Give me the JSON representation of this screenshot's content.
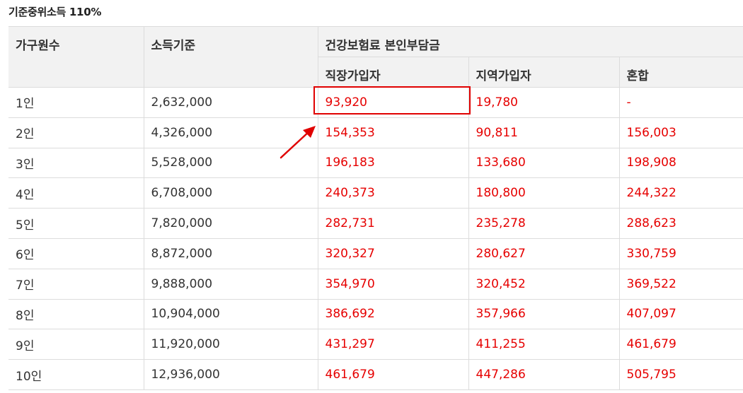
{
  "caption": "기준중위소득 110%",
  "headers": {
    "household": "가구원수",
    "income": "소득기준",
    "premium_group": "건강보험료 본인부담금",
    "employee": "직장가입자",
    "regional": "지역가입자",
    "mixed": "혼합"
  },
  "rows": [
    {
      "household": "1인",
      "income": "2,632,000",
      "employee": "93,920",
      "regional": "19,780",
      "mixed": "-"
    },
    {
      "household": "2인",
      "income": "4,326,000",
      "employee": "154,353",
      "regional": "90,811",
      "mixed": "156,003"
    },
    {
      "household": "3인",
      "income": "5,528,000",
      "employee": "196,183",
      "regional": "133,680",
      "mixed": "198,908"
    },
    {
      "household": "4인",
      "income": "6,708,000",
      "employee": "240,373",
      "regional": "180,800",
      "mixed": "244,322"
    },
    {
      "household": "5인",
      "income": "7,820,000",
      "employee": "282,731",
      "regional": "235,278",
      "mixed": "288,623"
    },
    {
      "household": "6인",
      "income": "8,872,000",
      "employee": "320,327",
      "regional": "280,627",
      "mixed": "330,759"
    },
    {
      "household": "7인",
      "income": "9,888,000",
      "employee": "354,970",
      "regional": "320,452",
      "mixed": "369,522"
    },
    {
      "household": "8인",
      "income": "10,904,000",
      "employee": "386,692",
      "regional": "357,966",
      "mixed": "407,097"
    },
    {
      "household": "9인",
      "income": "11,920,000",
      "employee": "431,297",
      "regional": "411,255",
      "mixed": "461,679"
    },
    {
      "household": "10인",
      "income": "12,936,000",
      "employee": "461,679",
      "regional": "447,286",
      "mixed": "505,795"
    }
  ],
  "colors": {
    "value_text": "#e60000",
    "highlight": "#e00000",
    "header_bg": "#f2f2f2",
    "border": "#dcdcdc"
  },
  "annotations": {
    "highlight_target": "1인 직장가입자",
    "arrow_icon": "arrow-up-right-icon"
  }
}
